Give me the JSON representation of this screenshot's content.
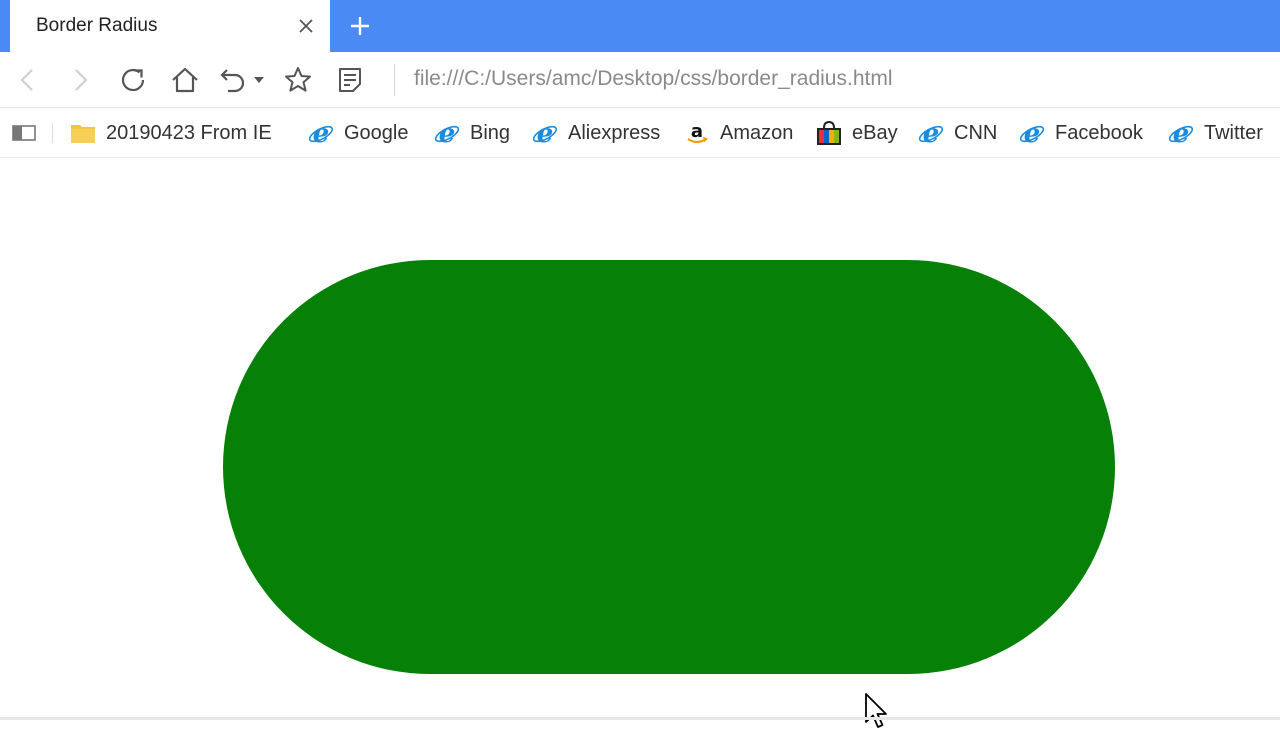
{
  "tab": {
    "title": "Border Radius"
  },
  "address_bar": {
    "url": "file:///C:/Users/amc/Desktop/css/border_radius.html"
  },
  "bookmarks": [
    {
      "label": "20190423 From IE",
      "icon": "folder-icon"
    },
    {
      "label": "Google",
      "icon": "ie-icon"
    },
    {
      "label": "Bing",
      "icon": "ie-icon"
    },
    {
      "label": "Aliexpress",
      "icon": "ie-icon"
    },
    {
      "label": "Amazon",
      "icon": "amazon-icon"
    },
    {
      "label": "eBay",
      "icon": "ebay-icon"
    },
    {
      "label": "CNN",
      "icon": "ie-icon"
    },
    {
      "label": "Facebook",
      "icon": "ie-icon"
    },
    {
      "label": "Twitter",
      "icon": "ie-icon"
    }
  ],
  "colors": {
    "tabstrip": "#4a8af4",
    "pill": "#078007",
    "ie_blue": "#1a8ce0",
    "folder": "#f5c242"
  }
}
